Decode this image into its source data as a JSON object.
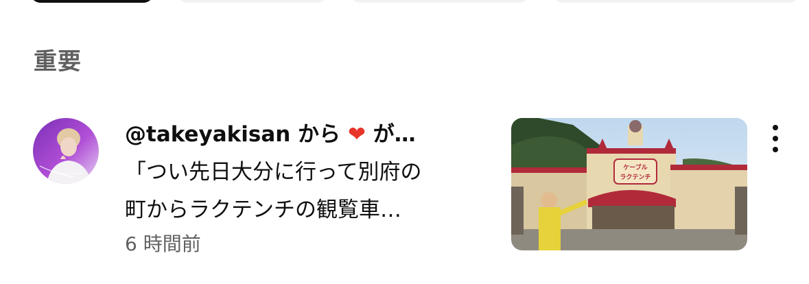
{
  "section": {
    "title": "重要"
  },
  "notification": {
    "user": "@takeyakisan",
    "header_from": "から",
    "header_suffix": "が…",
    "reaction_icon": "red-heart-icon",
    "body_line1": "「つい先日大分に行って別府の",
    "body_line2": "町からラクテンチの観覧車…",
    "time": "6 時間前",
    "thumbnail_sign_text": "ケーブル\nラクテンチ"
  },
  "colors": {
    "primary_text": "#0f0f0f",
    "secondary_text": "#606060",
    "section_title": "#5f5f5f",
    "heart": "#e8352a"
  }
}
